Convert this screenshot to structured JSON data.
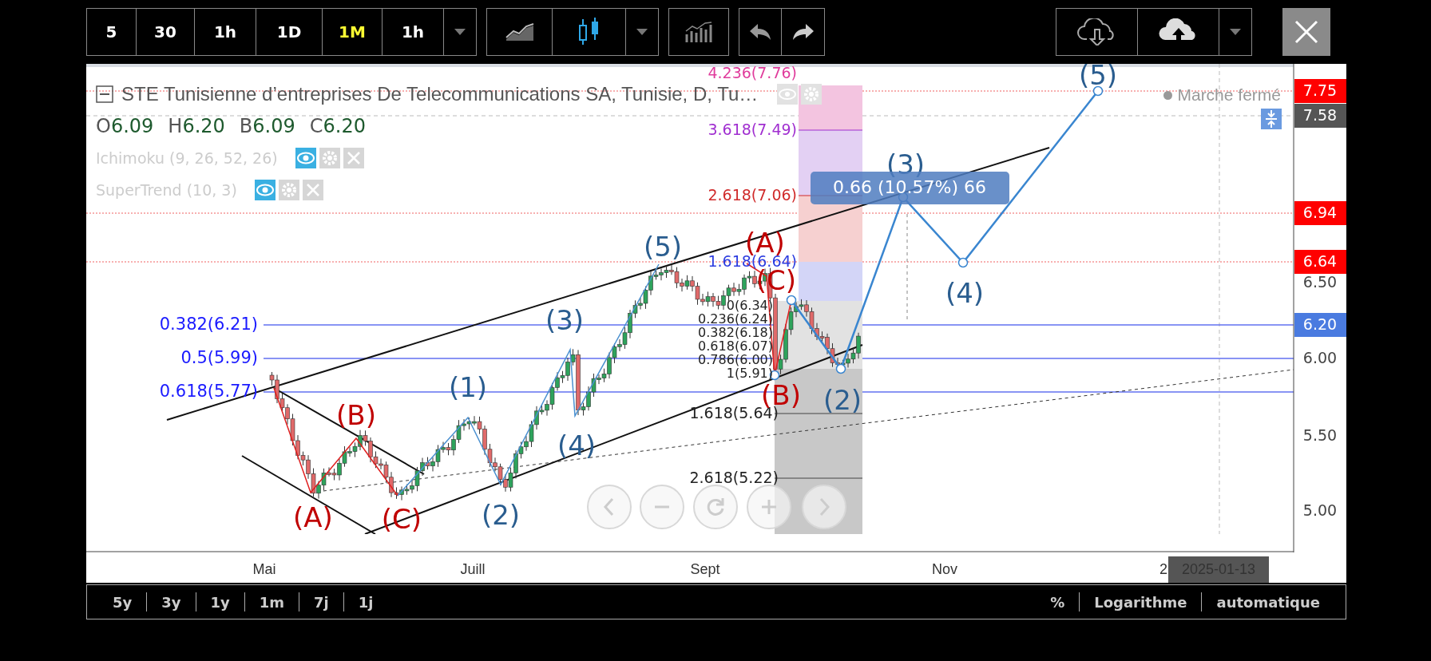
{
  "toolbar": {
    "intervals": [
      {
        "label": "5",
        "selected": false
      },
      {
        "label": "30",
        "selected": false
      },
      {
        "label": "1h",
        "selected": false
      },
      {
        "label": "1D",
        "selected": false
      },
      {
        "label": "1M",
        "selected": true
      },
      {
        "label": "1h",
        "selected": false
      }
    ]
  },
  "legend": {
    "title": "STE Tunisienne d’entreprises De Telecommunications SA, Tunisie, D, Tu…",
    "ohlc": [
      {
        "letter": "O",
        "value": "6.09"
      },
      {
        "letter": "H",
        "value": "6.20"
      },
      {
        "letter": "B",
        "value": "6.09"
      },
      {
        "letter": "C",
        "value": "6.20"
      }
    ],
    "indicators": [
      "Ichimoku (9, 26, 52, 26)",
      "SuperTrend (10, 3)"
    ],
    "market_status": "Marche fermé"
  },
  "chart": {
    "price_axis": [
      {
        "text": "7.75",
        "kind": "alert"
      },
      {
        "text": "7.58",
        "kind": "cursor"
      },
      {
        "text": "6.94",
        "kind": "alert"
      },
      {
        "text": "6.64",
        "kind": "alert"
      },
      {
        "text": "6.50",
        "kind": "tick"
      },
      {
        "text": "6.20",
        "kind": "last"
      },
      {
        "text": "6.00",
        "kind": "tick"
      },
      {
        "text": "5.50",
        "kind": "tick"
      },
      {
        "text": "5.00",
        "kind": "tick"
      }
    ],
    "retracement_levels": [
      "0.382(6.21)",
      "0.5(5.99)",
      "0.618(5.77)"
    ],
    "fib_extensions": [
      {
        "label": "4.236(7.76)",
        "color": "#e03c9c"
      },
      {
        "label": "3.618(7.49)",
        "color": "#a02ed0"
      },
      {
        "label": "2.618(7.06)",
        "color": "#d02a2a"
      },
      {
        "label": "1.618(6.64)",
        "color": "#2c3ce0"
      },
      {
        "label": "1.618(5.64)",
        "color": "#222222"
      },
      {
        "label": "2.618(5.22)",
        "color": "#222222"
      }
    ],
    "fib_retracements": [
      "0(6.34)",
      "0.236(6.24)",
      "0.382(6.18)",
      "0.618(6.07)",
      "0.786(6.00)",
      "1(5.91)"
    ],
    "waves": [
      {
        "label": "(A)",
        "color": "#c00000"
      },
      {
        "label": "(B)",
        "color": "#c00000"
      },
      {
        "label": "(C)",
        "color": "#c00000"
      },
      {
        "label": "(1)",
        "color": "#2a5d8f"
      },
      {
        "label": "(2)",
        "color": "#2a5d8f"
      },
      {
        "label": "(3)",
        "color": "#2a5d8f"
      },
      {
        "label": "(4)",
        "color": "#2a5d8f"
      },
      {
        "label": "(5)",
        "color": "#2a5d8f"
      },
      {
        "label": "(A)",
        "color": "#c00000"
      },
      {
        "label": "(B)",
        "color": "#c00000"
      },
      {
        "label": "(C)",
        "color": "#c00000"
      },
      {
        "label": "(2)",
        "color": "#2a5d8f"
      },
      {
        "label": "(3)",
        "color": "#2a5d8f"
      },
      {
        "label": "(4)",
        "color": "#2a5d8f"
      },
      {
        "label": "(5)",
        "color": "#2a5d8f"
      }
    ],
    "measure": "0.66 (10.57%) 66"
  },
  "x_axis": {
    "labels": [
      "Mai",
      "Juill",
      "Sept",
      "Nov",
      "2"
    ],
    "cursor_date": "2025-01-13"
  },
  "ranges": [
    "5y",
    "3y",
    "1y",
    "1m",
    "7j",
    "1j"
  ],
  "scale_options": [
    "%",
    "Logarithme",
    "automatique"
  ]
}
